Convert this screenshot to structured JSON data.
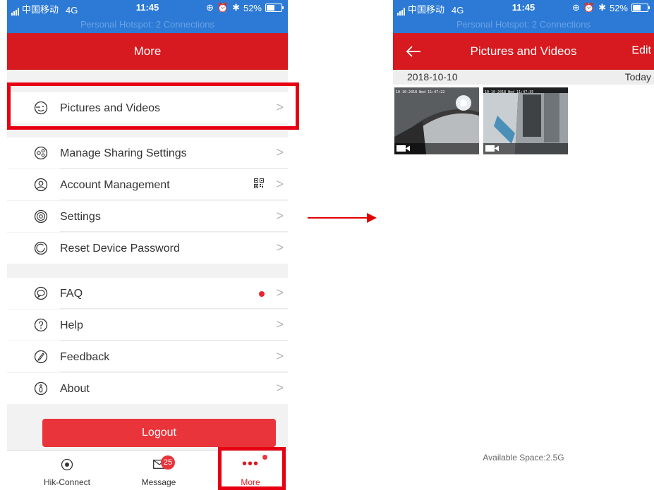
{
  "left": {
    "status": {
      "carrier": "中国移动",
      "network": "4G",
      "time": "11:45",
      "battery": "52%",
      "hotspot": "Personal Hotspot: 2 Connections"
    },
    "nav": {
      "title": "More"
    },
    "sections": [
      [
        {
          "label": "Pictures and Videos",
          "icon": "picture-face-icon"
        }
      ],
      [
        {
          "label": "Manage Sharing Settings",
          "icon": "share-icon"
        },
        {
          "label": "Account Management",
          "icon": "account-icon"
        },
        {
          "label": "Settings",
          "icon": "settings-icon"
        },
        {
          "label": "Reset Device Password",
          "icon": "reset-icon"
        }
      ],
      [
        {
          "label": "FAQ",
          "icon": "faq-icon"
        },
        {
          "label": "Help",
          "icon": "help-icon"
        },
        {
          "label": "Feedback",
          "icon": "feedback-icon"
        },
        {
          "label": "About",
          "icon": "about-icon"
        }
      ]
    ],
    "logout": "Logout",
    "tabs": [
      {
        "label": "Hik-Connect",
        "icon": "hik-connect-icon"
      },
      {
        "label": "Message",
        "icon": "message-icon",
        "badge": "25"
      },
      {
        "label": "More",
        "icon": "more-icon",
        "active": true
      }
    ]
  },
  "right": {
    "status": {
      "carrier": "中国移动",
      "network": "4G",
      "time": "11:45",
      "battery": "52%",
      "hotspot": "Personal Hotspot: 2 Connections"
    },
    "nav": {
      "title": "Pictures and Videos",
      "edit": "Edit"
    },
    "date": "2018-10-10",
    "today": "Today",
    "thumbnails": [
      {
        "caption": "10-10-2018 Wed 11:47:22"
      },
      {
        "caption": "10-10-2018 Wed 11:47:35"
      }
    ],
    "available_space": "Available Space:2.5G"
  },
  "colors": {
    "status_bar": "#2c7ad6",
    "nav_bar": "#d71a1f",
    "highlight": "#e60012",
    "logout": "#e8343a"
  }
}
